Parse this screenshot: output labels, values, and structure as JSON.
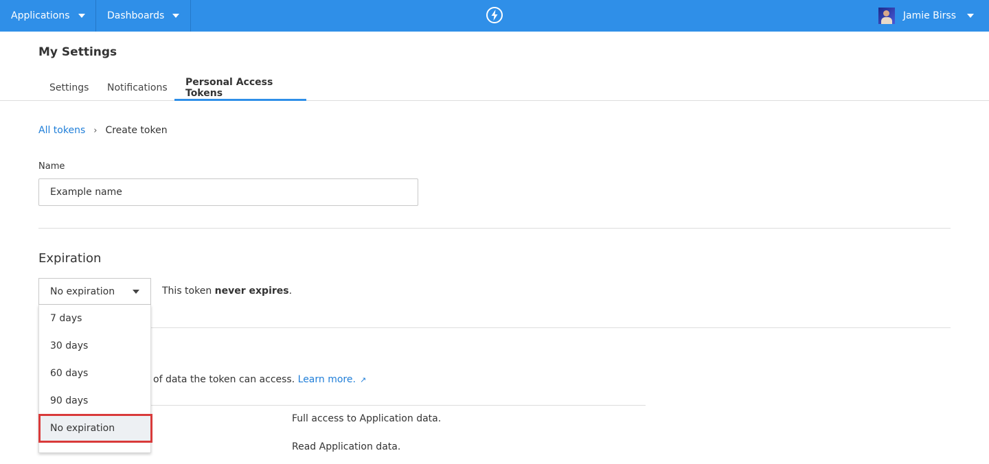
{
  "topbar": {
    "nav": [
      {
        "label": "Applications"
      },
      {
        "label": "Dashboards"
      }
    ],
    "logo_icon": "bolt-icon",
    "user": {
      "name": "Jamie Birss"
    },
    "accent": "#2f8fe8"
  },
  "page": {
    "title": "My Settings",
    "tabs": [
      {
        "label": "Settings"
      },
      {
        "label": "Notifications"
      },
      {
        "label": "Personal Access Tokens",
        "active": true
      }
    ]
  },
  "breadcrumb": {
    "parent": "All tokens",
    "current": "Create token"
  },
  "name_field": {
    "label": "Name",
    "value": "Example name"
  },
  "expiration": {
    "heading": "Expiration",
    "selected": "No expiration",
    "note_prefix": "This token ",
    "note_bold": "never expires",
    "note_suffix": ".",
    "options": [
      "7 days",
      "30 days",
      "60 days",
      "90 days",
      "No expiration"
    ]
  },
  "scopes": {
    "text": "of data the token can access. ",
    "link": "Learn more.",
    "rows": [
      {
        "description": "Full access to Application data."
      },
      {
        "description": "Read Application data."
      }
    ]
  }
}
